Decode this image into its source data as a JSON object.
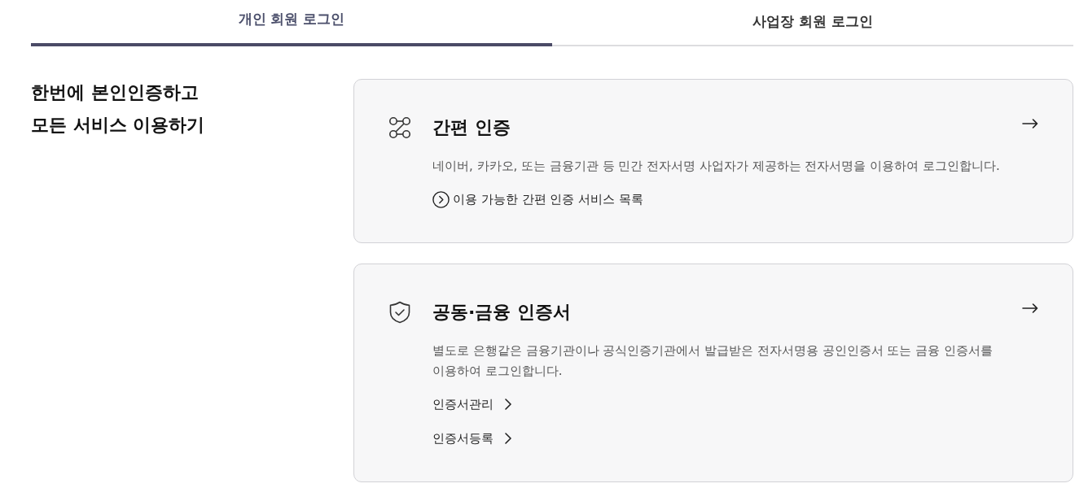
{
  "tabs": [
    {
      "label": "개인 회원 로그인",
      "selected": true
    },
    {
      "label": "사업장 회원 로그인",
      "selected": false
    }
  ],
  "intro": {
    "heading_lines": [
      "한번에 본인인증하고",
      "모든 서비스 이용하기"
    ]
  },
  "cards": [
    {
      "kind": "simple",
      "title": "간편 인증",
      "description": "네이버, 카카오, 또는 금융기관 등 민간 전자서명 사업자가 제공하는 전자서명을 이용하여 로그인합니다.",
      "links": [
        {
          "label": "이용 가능한 간편 인증 서비스 목록"
        }
      ]
    },
    {
      "kind": "certificate",
      "title": "공동·금융 인증서",
      "description": "별도로 은행같은 금융기관이나 공식인증기관에서 발급받은 전자서명용 공인인증서 또는 금융 인증서를 이용하여 로그인합니다.",
      "links": [
        {
          "label": "인증서관리"
        },
        {
          "label": "인증서등록"
        }
      ]
    }
  ]
}
